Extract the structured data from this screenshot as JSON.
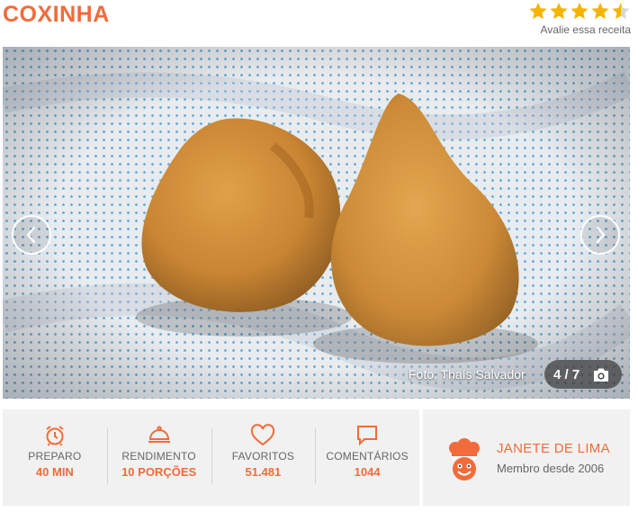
{
  "recipe": {
    "title": "COXINHA"
  },
  "rating": {
    "value": 4.5,
    "max": 5,
    "label": "Avalie essa receita",
    "color": "#f5b400"
  },
  "gallery": {
    "credit": "Foto: Thaís Salvador",
    "counter": "4 / 7",
    "prev_icon": "chevron-left-icon",
    "next_icon": "chevron-right-icon",
    "camera_icon": "camera-icon"
  },
  "stats": [
    {
      "icon": "alarm-clock-icon",
      "label": "PREPARO",
      "value": "40 MIN"
    },
    {
      "icon": "serving-dish-icon",
      "label": "RENDIMENTO",
      "value": "10 PORÇÕES"
    },
    {
      "icon": "heart-icon",
      "label": "FAVORITOS",
      "value": "51.481"
    },
    {
      "icon": "speech-bubble-icon",
      "label": "COMENTÁRIOS",
      "value": "1044"
    }
  ],
  "author": {
    "name": "JANETE DE LIMA",
    "since": "Membro desde 2006",
    "avatar_icon": "chef-avatar-icon"
  },
  "colors": {
    "accent": "#f26b3a",
    "panel": "#f1f1f1"
  }
}
